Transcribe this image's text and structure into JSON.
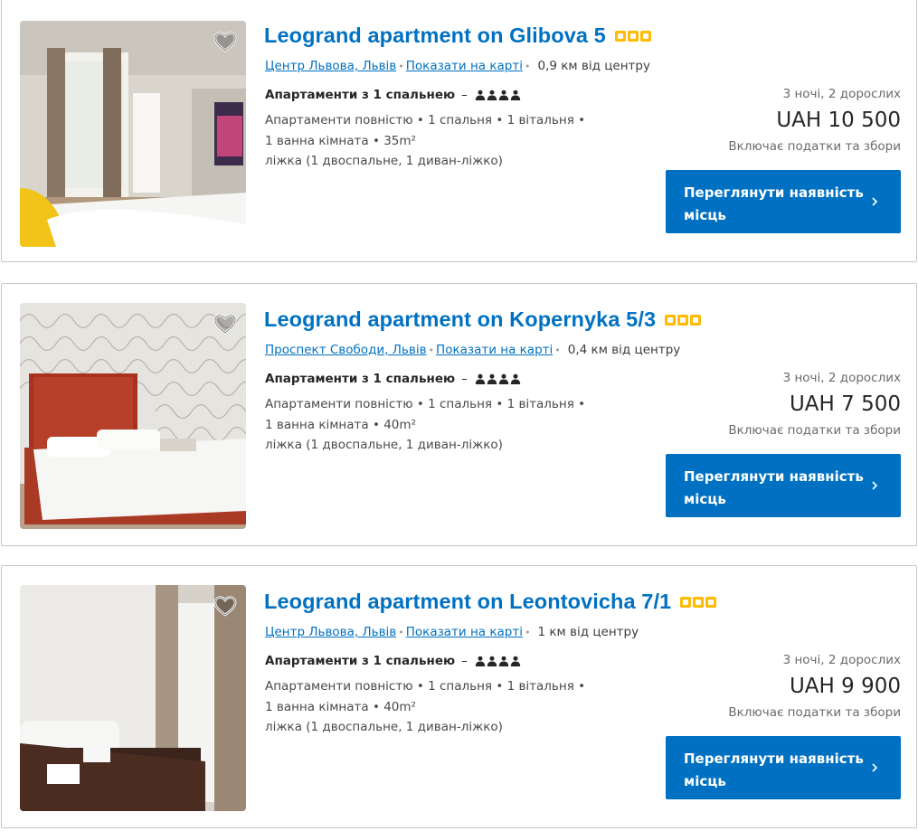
{
  "listings": [
    {
      "title": "Leogrand apartment on Glibova 5",
      "stars": 3,
      "area_link": "Центр Львова, Львів",
      "map_link": "Показати на карті",
      "distance": "0,9 км від центру",
      "room_type": "Апартаменти з 1 спальнею",
      "room_dash": "–",
      "desc_line1": "Апартаменти повністю • 1 спальня • 1 вітальня •",
      "desc_line2": "1 ванна кімната • 35m²",
      "desc_line3": "ліжка (1 двоспальне, 1 диван-ліжко)",
      "stay": "3 ночі, 2 дорослих",
      "price": "UAH 10 500",
      "taxes": "Включає податки та збори",
      "cta": "Переглянути наявність місць"
    },
    {
      "title": "Leogrand apartment on Kopernyka 5/3",
      "stars": 3,
      "area_link": "Проспект Свободи, Львів",
      "map_link": "Показати на карті",
      "distance": "0,4 км від центру",
      "room_type": "Апартаменти з 1 спальнею",
      "room_dash": "–",
      "desc_line1": "Апартаменти повністю • 1 спальня • 1 вітальня •",
      "desc_line2": "1 ванна кімната • 40m²",
      "desc_line3": "ліжка (1 двоспальне, 1 диван-ліжко)",
      "stay": "3 ночі, 2 дорослих",
      "price": "UAH 7 500",
      "taxes": "Включає податки та збори",
      "cta": "Переглянути наявність місць"
    },
    {
      "title": "Leogrand apartment on Leontovicha 7/1",
      "stars": 3,
      "area_link": "Центр Львова, Львів",
      "map_link": "Показати на карті",
      "distance": "1 км від центру",
      "room_type": "Апартаменти з 1 спальнею",
      "room_dash": "–",
      "desc_line1": "Апартаменти повністю • 1 спальня • 1 вітальня •",
      "desc_line2": "1 ванна кімната • 40m²",
      "desc_line3": "ліжка (1 двоспальне, 1 диван-ліжко)",
      "stay": "3 ночі, 2 дорослих",
      "price": "UAH 9 900",
      "taxes": "Включає податки та збори",
      "cta": "Переглянути наявність місць"
    }
  ],
  "colors": {
    "link": "#0071c2",
    "cta_bg": "#0071c2",
    "star": "#febb02"
  },
  "icons": [
    "heart-icon",
    "star-icon",
    "person-icon",
    "chevron-right-icon",
    "map-pin-separator"
  ]
}
